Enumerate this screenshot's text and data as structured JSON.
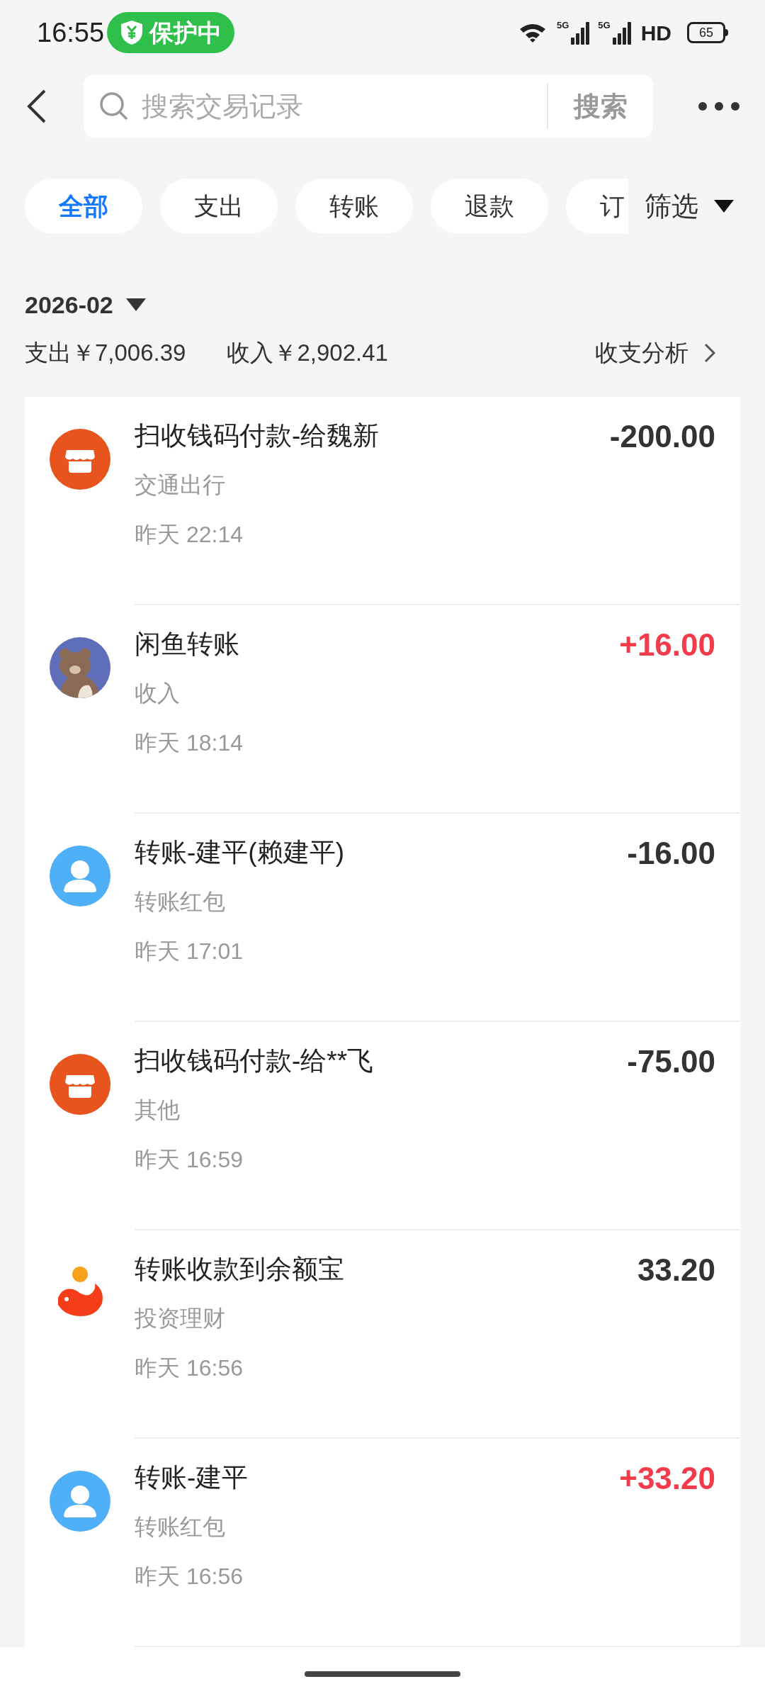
{
  "status_bar": {
    "time": "16:55",
    "protect_badge": "保护中",
    "signals": [
      "5G",
      "5G"
    ],
    "hd": "HD",
    "battery": "65"
  },
  "search": {
    "placeholder": "搜索交易记录",
    "button": "搜索"
  },
  "filters": [
    {
      "label": "全部",
      "selected": true
    },
    {
      "label": "支出",
      "selected": false
    },
    {
      "label": "转账",
      "selected": false
    },
    {
      "label": "退款",
      "selected": false
    },
    {
      "label": "订",
      "selected": false
    }
  ],
  "filter_button": "筛选",
  "month": "2026-02",
  "summary": {
    "expense": "支出￥7,006.39",
    "income": "收入￥2,902.41",
    "analysis": "收支分析"
  },
  "transactions": [
    {
      "kind": "shop",
      "title": "扫收钱码付款-给魏新",
      "category": "交通出行",
      "time": "昨天 22:14",
      "amount": "-200.00",
      "income": false
    },
    {
      "kind": "bear",
      "title": "闲鱼转账",
      "category": "收入",
      "time": "昨天 18:14",
      "amount": "+16.00",
      "income": true
    },
    {
      "kind": "person",
      "title": "转账-建平(赖建平)",
      "category": "转账红包",
      "time": "昨天 17:01",
      "amount": "-16.00",
      "income": false
    },
    {
      "kind": "shop",
      "title": "扫收钱码付款-给**飞",
      "category": "其他",
      "time": "昨天 16:59",
      "amount": "-75.00",
      "income": false
    },
    {
      "kind": "fish",
      "title": "转账收款到余额宝",
      "category": "投资理财",
      "time": "昨天 16:56",
      "amount": "33.20",
      "income": false
    },
    {
      "kind": "person",
      "title": "转账-建平",
      "category": "转账红包",
      "time": "昨天 16:56",
      "amount": "+33.20",
      "income": true
    }
  ]
}
